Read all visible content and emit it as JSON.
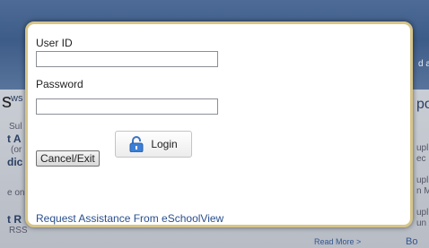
{
  "login_dialog": {
    "user_id_label": "User ID",
    "user_id_value": "",
    "password_label": "Password",
    "password_value": "",
    "cancel_label": "Cancel/Exit",
    "login_label": "Login",
    "assist_link": "Request Assistance From eSchoolView"
  },
  "background_fragments": {
    "s": "s",
    "ws": "ws",
    "sul": "Sul",
    "t_a": "t A",
    "paren_or": "(or",
    "dic": "dic",
    "e_on": "e on",
    "t_r": "t R",
    "rss": "RSS",
    "d_a": "d a",
    "po": "po",
    "upl1": "upl",
    "ec": "ec",
    "upl2": "upl",
    "n_m": "n M",
    "upl3": "upl",
    "un": "un",
    "read_more": "Read More >",
    "bo": "Bo"
  },
  "colors": {
    "modal_border": "#d7c58a",
    "link": "#2a4f8e",
    "banner": "#4d6b96"
  }
}
